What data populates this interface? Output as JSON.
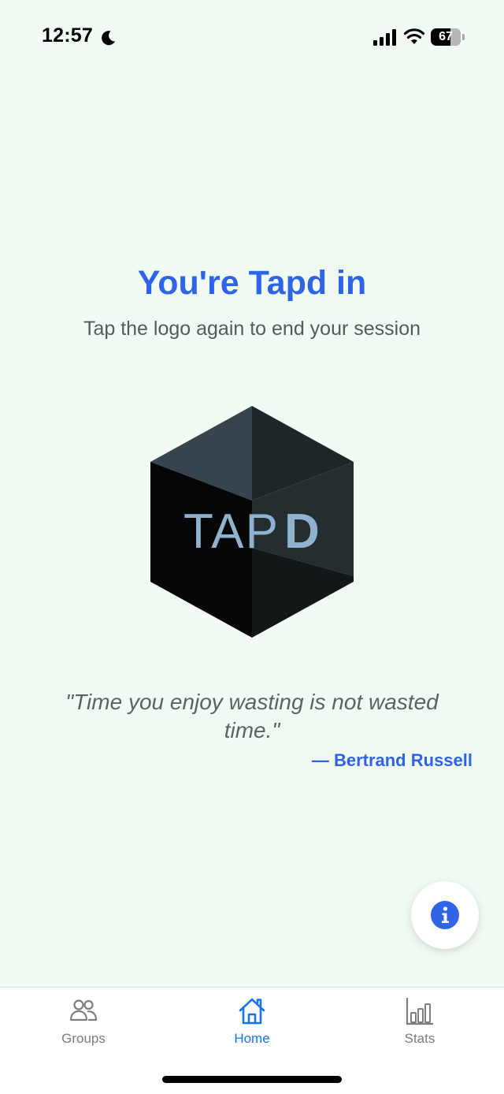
{
  "status_bar": {
    "time": "12:57",
    "moon_icon": "moon-icon",
    "battery_level": "67",
    "battery_percent": 67
  },
  "main": {
    "headline": "You're Tapd in",
    "subline": "Tap the logo again to end your session",
    "logo": {
      "text_light": "TAP",
      "text_bold": "D",
      "icon": "tapd-cube-logo"
    },
    "quote": {
      "text": "\"Time you enjoy wasting is not wasted time.\"",
      "author": "— Bertrand Russell"
    },
    "info_button_icon": "info-icon"
  },
  "tab_bar": {
    "tabs": [
      {
        "label": "Groups",
        "icon": "groups-icon",
        "active": false
      },
      {
        "label": "Home",
        "icon": "home-icon",
        "active": true
      },
      {
        "label": "Stats",
        "icon": "stats-icon",
        "active": false
      }
    ]
  },
  "colors": {
    "background": "#f0fbf4",
    "accent": "#2f63e8",
    "active_tab": "#1a73e8",
    "logo_text": "#8fb2cf"
  }
}
